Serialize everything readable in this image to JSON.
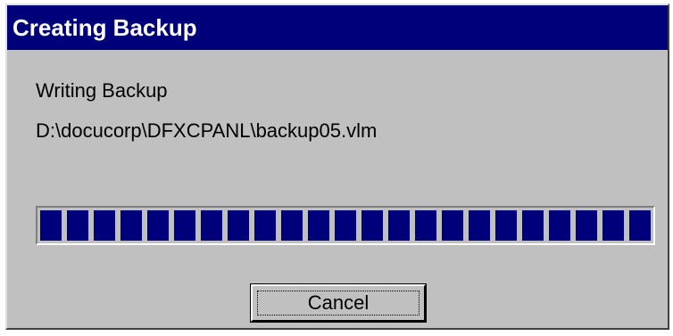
{
  "window": {
    "title": "Creating Backup"
  },
  "content": {
    "status": "Writing Backup",
    "file_path": "D:\\docucorp\\DFXCPANL\\backup05.vlm"
  },
  "progress": {
    "fraction": 1.0,
    "color": "#00007b"
  },
  "buttons": {
    "cancel_label": "Cancel"
  },
  "colors": {
    "titlebar": "#00007b",
    "dialog_face": "#c0c0c0"
  }
}
